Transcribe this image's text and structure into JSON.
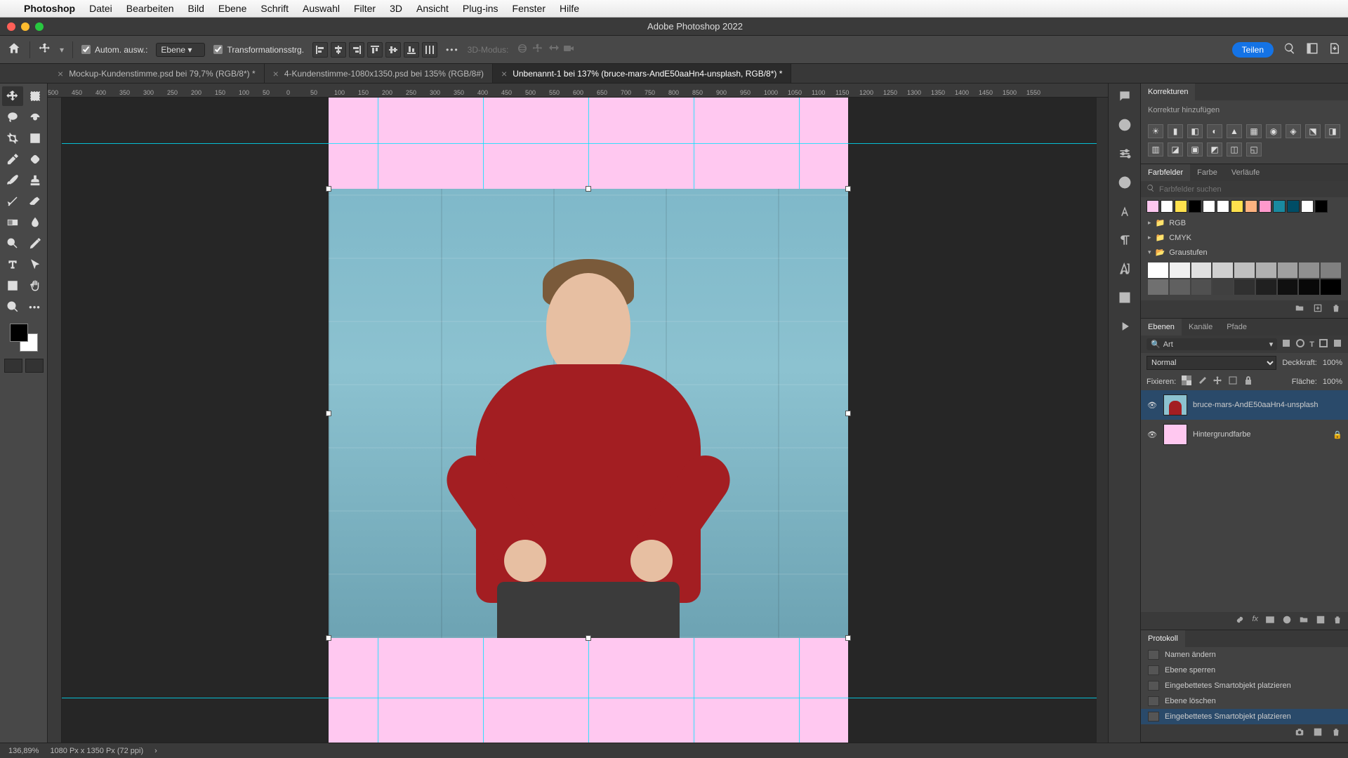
{
  "menubar": {
    "app": "Photoshop",
    "items": [
      "Datei",
      "Bearbeiten",
      "Bild",
      "Ebene",
      "Schrift",
      "Auswahl",
      "Filter",
      "3D",
      "Ansicht",
      "Plug-ins",
      "Fenster",
      "Hilfe"
    ]
  },
  "window": {
    "title": "Adobe Photoshop 2022"
  },
  "options": {
    "auto_select_label": "Autom. ausw.:",
    "auto_select_target": "Ebene",
    "transform_label": "Transformationsstrg.",
    "mode3d_label": "3D-Modus:",
    "share_label": "Teilen"
  },
  "tabs": [
    {
      "label": "Mockup-Kundenstimme.psd bei 79,7% (RGB/8*) *",
      "active": false
    },
    {
      "label": "4-Kundenstimme-1080x1350.psd bei 135% (RGB/8#)",
      "active": false
    },
    {
      "label": "Unbenannt-1 bei 137% (bruce-mars-AndE50aaHn4-unsplash, RGB/8*) *",
      "active": true
    }
  ],
  "ruler_h": [
    "500",
    "450",
    "400",
    "350",
    "300",
    "250",
    "200",
    "150",
    "100",
    "50",
    "0",
    "50",
    "100",
    "150",
    "200",
    "250",
    "300",
    "350",
    "400",
    "450",
    "500",
    "550",
    "600",
    "650",
    "700",
    "750",
    "800",
    "850",
    "900",
    "950",
    "1000",
    "1050",
    "1100",
    "1150",
    "1200",
    "1250",
    "1300",
    "1350",
    "1400",
    "1450",
    "1500",
    "1550"
  ],
  "status": {
    "zoom": "136,89%",
    "dims": "1080 Px x 1350 Px (72 ppi)"
  },
  "panels": {
    "adjustments": {
      "title": "Korrekturen",
      "add_label": "Korrektur hinzufügen"
    },
    "swatches": {
      "tabs": [
        "Farbfelder",
        "Farbe",
        "Verläufe"
      ],
      "search_placeholder": "Farbfelder suchen",
      "top_colors": [
        "#ffc8f0",
        "#ffffff",
        "#ffe14d",
        "#000000",
        "#ffffff",
        "#ffffff",
        "#ffe14d",
        "#ffb380",
        "#ff99cc",
        "#1a8aa0",
        "#004d66",
        "#ffffff",
        "#000000"
      ],
      "folders": [
        "RGB",
        "CMYK",
        "Graustufen"
      ],
      "grays": [
        "#ffffff",
        "#f0f0f0",
        "#e0e0e0",
        "#d0d0d0",
        "#c0c0c0",
        "#b0b0b0",
        "#a0a0a0",
        "#909090",
        "#808080",
        "#707070",
        "#606060",
        "#505050",
        "#404040",
        "#303030",
        "#202020",
        "#101010",
        "#080808",
        "#000000"
      ]
    },
    "layers": {
      "tabs": [
        "Ebenen",
        "Kanäle",
        "Pfade"
      ],
      "filter_label": "Art",
      "blend_mode": "Normal",
      "opacity_label": "Deckkraft:",
      "opacity_value": "100%",
      "lock_label": "Fixieren:",
      "fill_label": "Fläche:",
      "fill_value": "100%",
      "items": [
        {
          "name": "bruce-mars-AndE50aaHn4-unsplash",
          "selected": true,
          "locked": false,
          "thumb": "photo"
        },
        {
          "name": "Hintergrundfarbe",
          "selected": false,
          "locked": true,
          "thumb": "pink"
        }
      ]
    },
    "history": {
      "title": "Protokoll",
      "items": [
        {
          "label": "Namen ändern",
          "selected": false
        },
        {
          "label": "Ebene sperren",
          "selected": false
        },
        {
          "label": "Eingebettetes Smartobjekt platzieren",
          "selected": false
        },
        {
          "label": "Ebene löschen",
          "selected": false
        },
        {
          "label": "Eingebettetes Smartobjekt platzieren",
          "selected": true
        }
      ]
    }
  },
  "colors": {
    "canvas_bg": "#ffc8f0",
    "guide": "#00e5ff"
  }
}
